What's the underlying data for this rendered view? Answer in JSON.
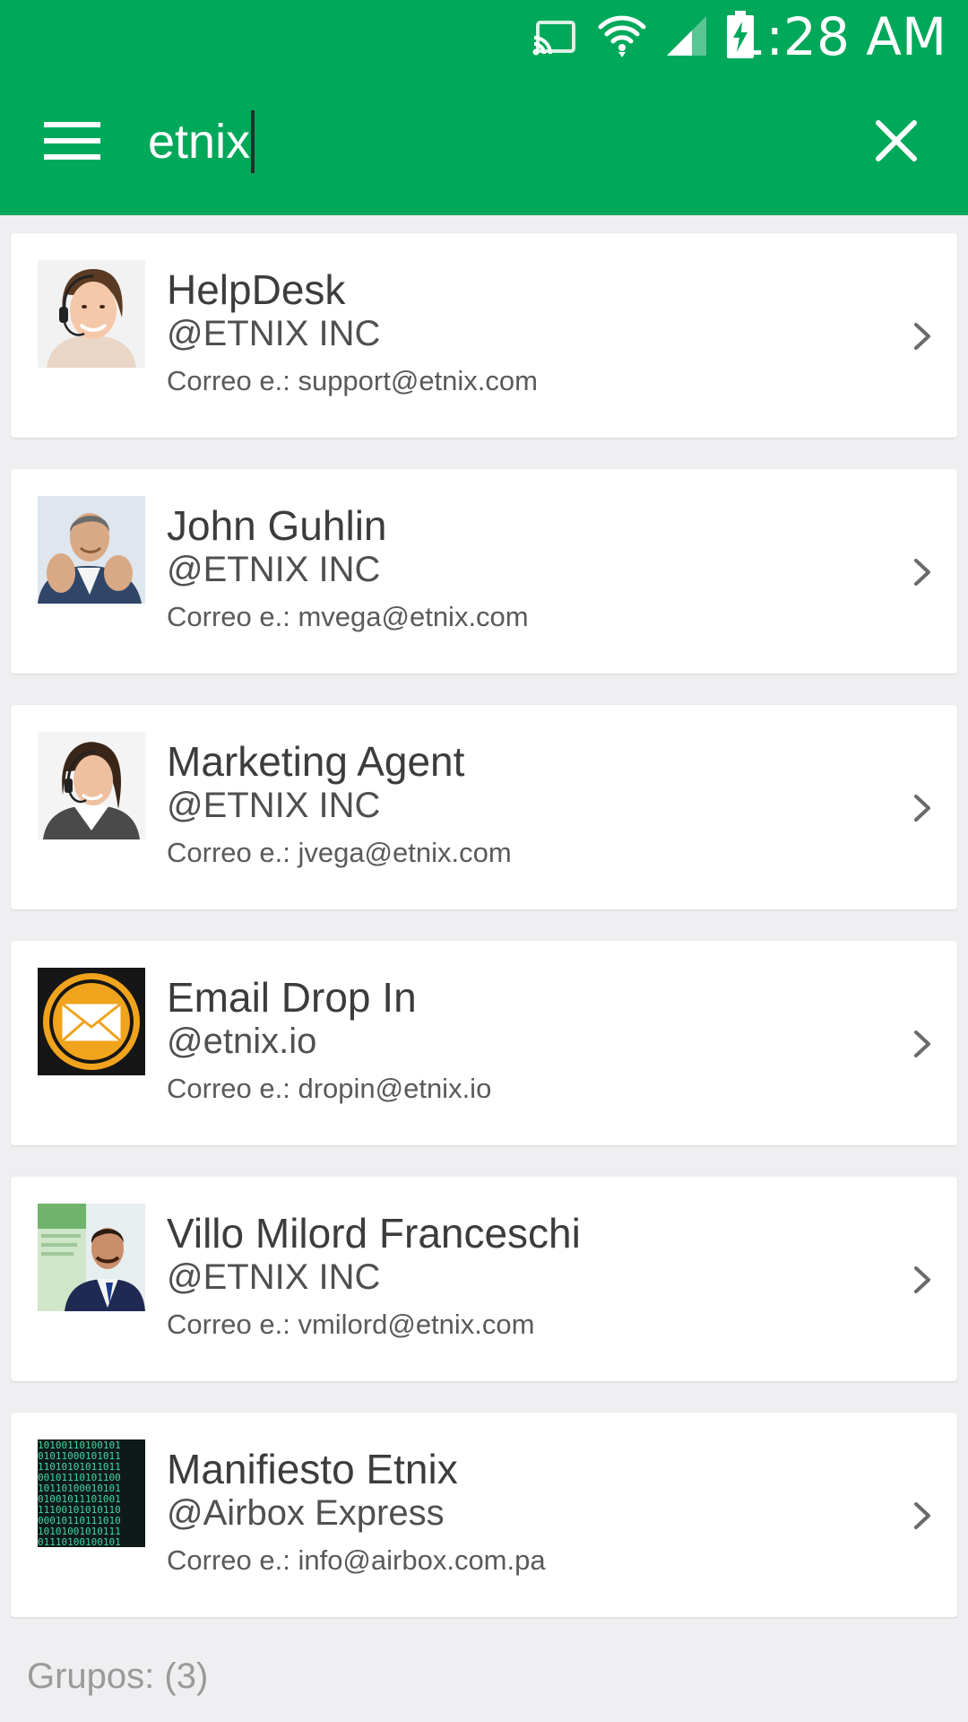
{
  "status_bar": {
    "time": "1:28 AM",
    "icons": [
      "cast-icon",
      "wifi-icon",
      "signal-icon",
      "battery-charging-icon"
    ]
  },
  "search": {
    "value": "etnix",
    "menu_icon": "hamburger-menu-icon",
    "clear_icon": "close-icon"
  },
  "colors": {
    "primary": "#00a85a",
    "background": "#efeff1",
    "card": "#ffffff"
  },
  "results": [
    {
      "name": "HelpDesk",
      "org": "@ETNIX INC",
      "email": "Correo e.: support@etnix.com",
      "avatar": "support-agent-photo"
    },
    {
      "name": "John Guhlin",
      "org": "@ETNIX INC",
      "email": "Correo e.: mvega@etnix.com",
      "avatar": "businessman-photo"
    },
    {
      "name": "Marketing Agent",
      "org": "@ETNIX INC",
      "email": "Correo e.: jvega@etnix.com",
      "avatar": "headset-agent-photo"
    },
    {
      "name": "Email Drop In",
      "org": "@etnix.io",
      "email": "Correo e.: dropin@etnix.io",
      "avatar": "envelope-logo"
    },
    {
      "name": "Villo Milord Franceschi",
      "org": "@ETNIX INC",
      "email": "Correo e.: vmilord@etnix.com",
      "avatar": "presenter-photo"
    },
    {
      "name": "Manifiesto Etnix",
      "org": "@Airbox Express",
      "email": "Correo e.: info@airbox.com.pa",
      "avatar": "binary-code-image"
    }
  ],
  "groups": {
    "label": "Grupos: (3)"
  }
}
